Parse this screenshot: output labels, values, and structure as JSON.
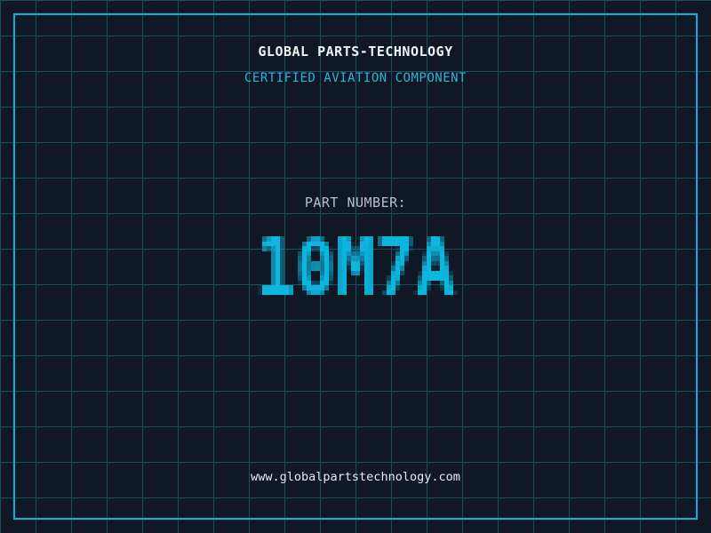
{
  "label": {
    "company_name": "GLOBAL PARTS-TECHNOLOGY",
    "certification": "CERTIFIED AVIATION COMPONENT",
    "part_number_label": "PART NUMBER:",
    "part_number": "10M7A",
    "website": "www.globalpartstechnology.com"
  },
  "colors": {
    "background": "#101826",
    "grid_line": "#1a4e63",
    "frame_border": "#0cb4d8",
    "company_name_color": "#f2f4f6",
    "certification_color": "#2fb3d6",
    "part_number_label_color": "#b9bec9",
    "part_number_color": "#0db6dc",
    "website_color": "#e8eaee"
  }
}
